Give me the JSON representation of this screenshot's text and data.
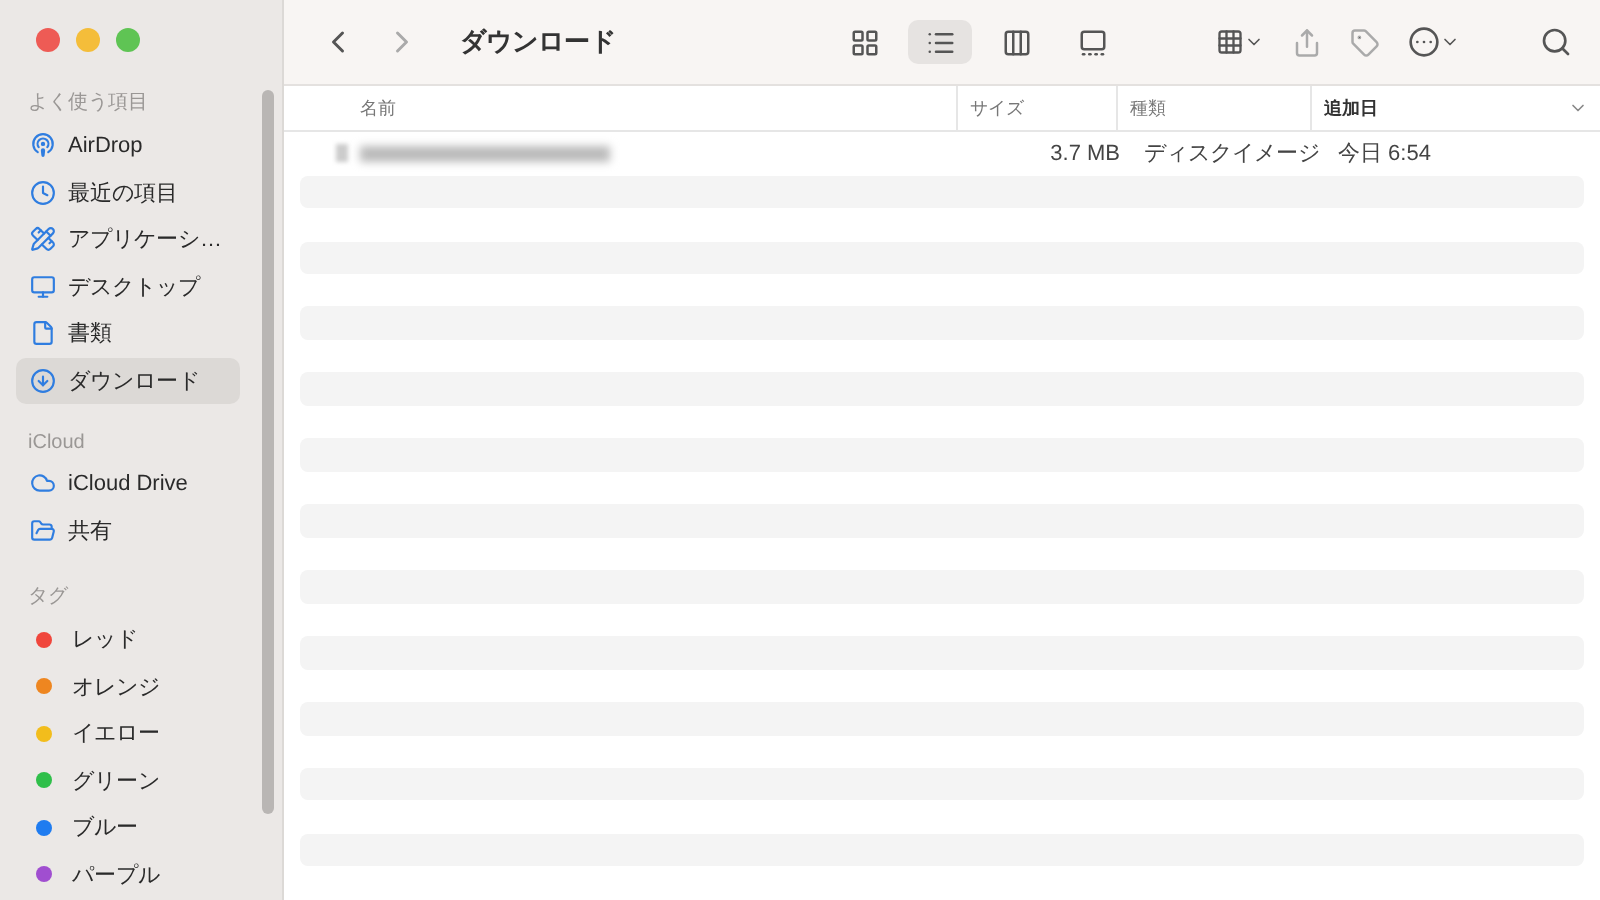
{
  "window": {
    "title": "ダウンロード"
  },
  "sidebar": {
    "sections": [
      {
        "heading": "よく使う項目",
        "items": [
          {
            "label": "AirDrop",
            "selected": false
          },
          {
            "label": "最近の項目",
            "selected": false
          },
          {
            "label": "アプリケーシ…",
            "selected": false
          },
          {
            "label": "デスクトップ",
            "selected": false
          },
          {
            "label": "書類",
            "selected": false
          },
          {
            "label": "ダウンロード",
            "selected": true
          }
        ]
      },
      {
        "heading": "iCloud",
        "items": [
          {
            "label": "iCloud Drive",
            "selected": false
          },
          {
            "label": "共有",
            "selected": false
          }
        ]
      },
      {
        "heading": "タグ",
        "tags": [
          {
            "label": "レッド",
            "color": "#f0463c"
          },
          {
            "label": "オレンジ",
            "color": "#ee8620"
          },
          {
            "label": "イエロー",
            "color": "#f2bd1c"
          },
          {
            "label": "グリーン",
            "color": "#2fbf4a"
          },
          {
            "label": "ブルー",
            "color": "#1f7cf0"
          },
          {
            "label": "パープル",
            "color": "#a04ed0"
          }
        ]
      }
    ]
  },
  "toolbar": {
    "views": [
      {
        "selected": false
      },
      {
        "selected": true
      },
      {
        "selected": false
      },
      {
        "selected": false
      }
    ]
  },
  "table": {
    "columns": [
      {
        "label": "名前",
        "sorted": false
      },
      {
        "label": "サイズ",
        "sorted": false
      },
      {
        "label": "種類",
        "sorted": false
      },
      {
        "label": "追加日",
        "sorted": true
      }
    ],
    "rows": [
      {
        "size": "3.7 MB",
        "kind": "ディスクイメージ",
        "added": "今日 6:54"
      }
    ]
  }
}
